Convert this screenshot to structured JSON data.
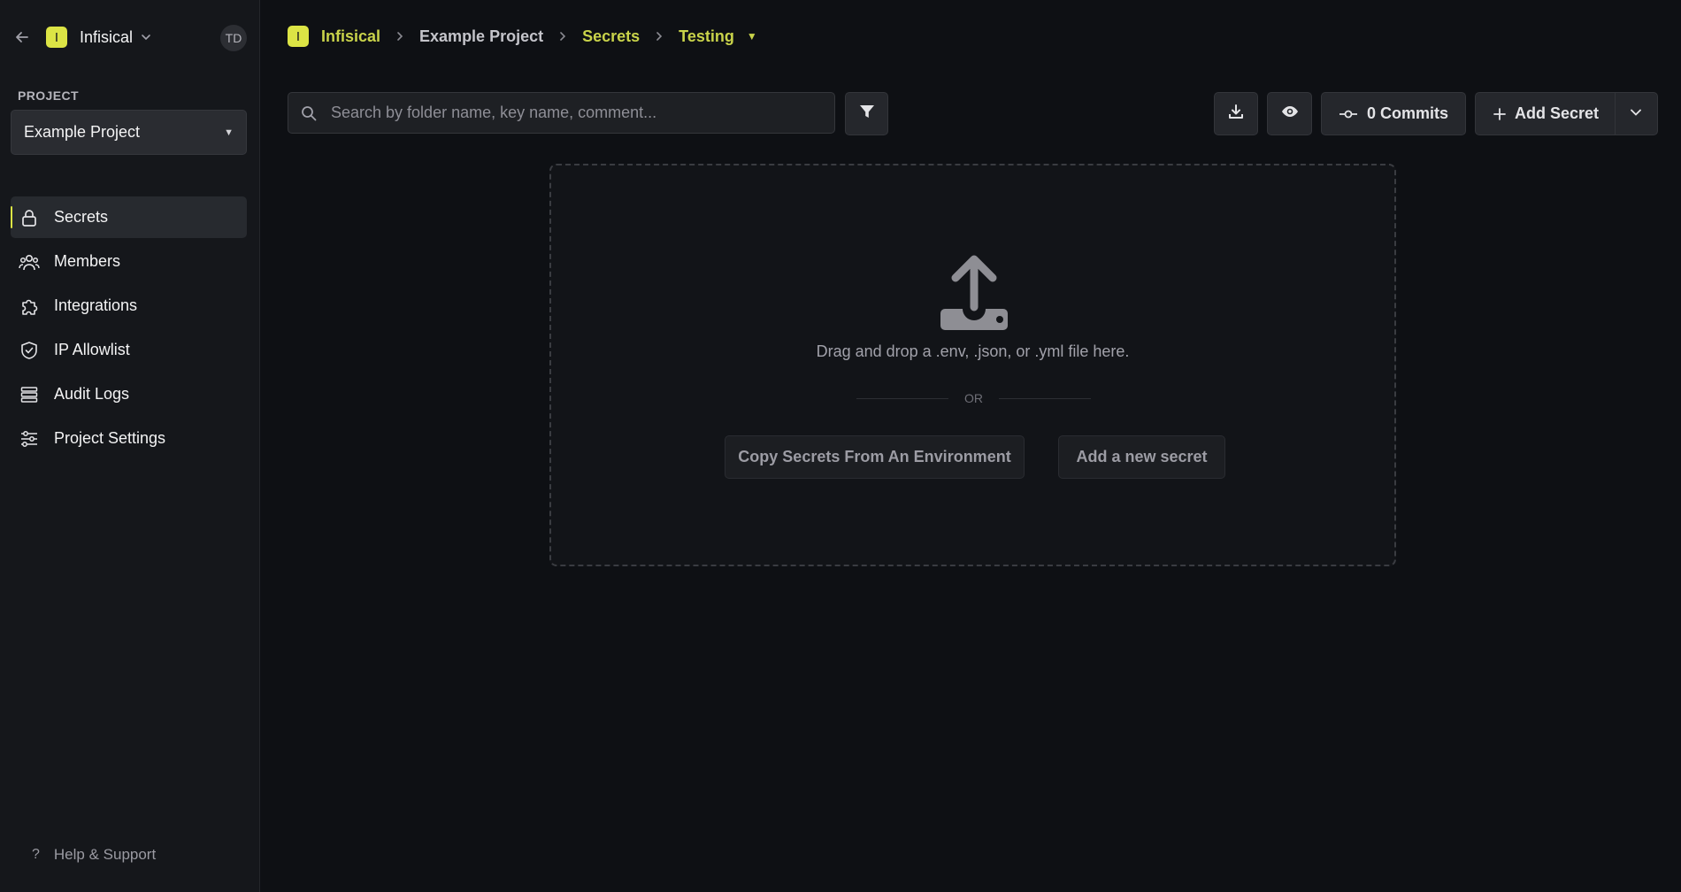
{
  "sidebar": {
    "org_logo_letter": "I",
    "org_name": "Infisical",
    "avatar_initials": "TD",
    "project_label": "PROJECT",
    "project_selected": "Example Project",
    "nav": [
      {
        "label": "Secrets",
        "icon": "lock-icon",
        "active": true
      },
      {
        "label": "Members",
        "icon": "users-icon"
      },
      {
        "label": "Integrations",
        "icon": "puzzle-icon"
      },
      {
        "label": "IP Allowlist",
        "icon": "shield-icon"
      },
      {
        "label": "Audit Logs",
        "icon": "list-icon"
      },
      {
        "label": "Project Settings",
        "icon": "sliders-icon"
      }
    ],
    "help_label": "Help & Support"
  },
  "breadcrumb": {
    "logo_letter": "I",
    "org": "Infisical",
    "project": "Example Project",
    "section": "Secrets",
    "environment": "Testing"
  },
  "toolbar": {
    "search_placeholder": "Search by folder name, key name, comment...",
    "commits_label": "0 Commits",
    "add_secret_label": "Add Secret"
  },
  "dropzone": {
    "instructions": "Drag and drop a .env, .json, or .yml file here.",
    "or_label": "OR",
    "copy_button": "Copy Secrets From An Environment",
    "add_button": "Add a new secret"
  },
  "colors": {
    "accent": "#dce445",
    "background": "#0e1014",
    "sidebar": "#15171b"
  }
}
